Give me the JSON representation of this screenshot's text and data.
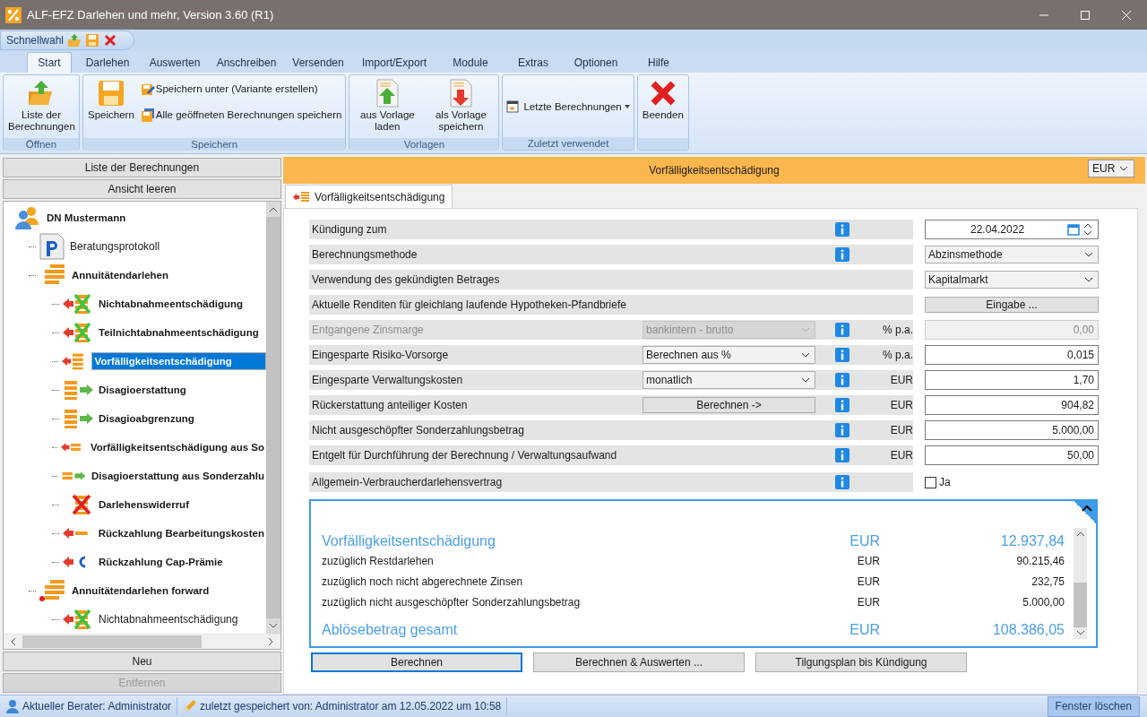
{
  "window": {
    "title": "ALF-EFZ Darlehen und mehr, Version 3.60 (R1)"
  },
  "quick_access": {
    "label": "Schnellwahl"
  },
  "ribbon_tabs": [
    {
      "label": "Start",
      "selected": true
    },
    {
      "label": "Darlehen",
      "selected": false
    },
    {
      "label": "Auswerten",
      "selected": false
    },
    {
      "label": "Anschreiben",
      "selected": false
    },
    {
      "label": "Versenden",
      "selected": false
    },
    {
      "label": "Import/Export",
      "selected": false
    },
    {
      "label": "Module",
      "selected": false
    },
    {
      "label": "Extras",
      "selected": false
    },
    {
      "label": "Optionen",
      "selected": false
    },
    {
      "label": "Hilfe",
      "selected": false
    }
  ],
  "ribbon_groups": [
    {
      "label": "Öffnen",
      "items": [
        {
          "kind": "large",
          "label": "Liste der Berechnungen"
        }
      ]
    },
    {
      "label": "Speichern",
      "items": [
        {
          "kind": "large",
          "label": "Speichern"
        },
        {
          "kind": "small",
          "label": "Speichern unter (Variante erstellen)"
        },
        {
          "kind": "small",
          "label": "Alle geöffneten Berechnungen speichern"
        }
      ]
    },
    {
      "label": "Vorlagen",
      "items": [
        {
          "kind": "large",
          "label": "aus Vorlage laden"
        },
        {
          "kind": "large",
          "label": "als Vorlage speichern"
        }
      ]
    },
    {
      "label": "Zuletzt verwendet",
      "items": [
        {
          "kind": "dropdown",
          "label": "Letzte Berechnungen"
        }
      ]
    },
    {
      "items": [
        {
          "kind": "large",
          "label": "Beenden"
        }
      ]
    }
  ],
  "left_panel": {
    "top_buttons": [
      "Liste der Berechnungen",
      "Ansicht leeren"
    ],
    "tree": [
      {
        "kind": "client",
        "label": "DN Mustermann",
        "emphasized": true,
        "selected": false,
        "children": [
          {
            "kind": "protocol",
            "label": "Beratungsprotokoll",
            "emphasized": false,
            "selected": false
          },
          {
            "kind": "loan",
            "label": "Annuitätendarlehen",
            "emphasized": true,
            "selected": false,
            "children": [
              {
                "kind": "penalty-x",
                "label": "Nichtabnahmeentschädigung",
                "emphasized": true,
                "selected": false
              },
              {
                "kind": "penalty-x",
                "label": "Teilnichtabnahmeentschädigung",
                "emphasized": true,
                "selected": false
              },
              {
                "kind": "penalty",
                "label": "Vorfälligkeitsentschädigung",
                "emphasized": true,
                "selected": true
              },
              {
                "kind": "refund",
                "label": "Disagioerstattung",
                "emphasized": true,
                "selected": false
              },
              {
                "kind": "refund",
                "label": "Disagioabgrenzung",
                "emphasized": true,
                "selected": false
              },
              {
                "kind": "penalty-small",
                "label": "Vorfälligkeitsentschädigung aus So",
                "emphasized": true,
                "selected": false
              },
              {
                "kind": "refund-small",
                "label": "Disagioerstattung aus Sonderzahlu",
                "emphasized": true,
                "selected": false
              },
              {
                "kind": "revocation",
                "label": "Darlehenswiderruf",
                "emphasized": true,
                "selected": false
              },
              {
                "kind": "cost",
                "label": "Rückzahlung Bearbeitungskosten",
                "emphasized": true,
                "selected": false
              },
              {
                "kind": "cap",
                "label": "Rückzahlung Cap-Prämie",
                "emphasized": true,
                "selected": false
              }
            ]
          },
          {
            "kind": "loan-forward",
            "label": "Annuitätendarlehen forward",
            "emphasized": true,
            "selected": false,
            "children": [
              {
                "kind": "penalty-x",
                "label": "Nichtabnahmeentschädigung",
                "emphasized": false,
                "selected": false
              }
            ]
          }
        ]
      }
    ],
    "bottom_buttons": [
      {
        "label": "Neu",
        "disabled": false
      },
      {
        "label": "Entfernen",
        "disabled": true
      }
    ]
  },
  "header": {
    "title": "Vorfälligkeitsentschädigung",
    "currency": "EUR"
  },
  "doc_tab": {
    "label": "Vorfälligkeitsentschädigung"
  },
  "form_rows": [
    {
      "label": "Kündigung zum",
      "disabled": false,
      "info": true,
      "control": {
        "kind": "date",
        "value": "22.04.2022"
      }
    },
    {
      "label": "Berechnungsmethode",
      "disabled": false,
      "info": true,
      "control": {
        "kind": "select",
        "value": "Abzinsmethode"
      }
    },
    {
      "label": "Verwendung des gekündigten Betrages",
      "disabled": false,
      "info": false,
      "control": {
        "kind": "select",
        "value": "Kapitalmarkt"
      }
    },
    {
      "label": "Aktuelle Renditen für gleichlang laufende Hypotheken-Pfandbriefe",
      "disabled": false,
      "info": false,
      "control": {
        "kind": "button",
        "value": "Eingabe ..."
      }
    },
    {
      "label": "Entgangene Zinsmarge",
      "disabled": true,
      "middle": {
        "kind": "select",
        "value": "bankintern - brutto"
      },
      "info": true,
      "unit": "% p.a.",
      "control": {
        "kind": "input",
        "value": "0,00"
      }
    },
    {
      "label": "Eingesparte Risiko-Vorsorge",
      "disabled": false,
      "middle": {
        "kind": "select",
        "value": "Berechnen aus %"
      },
      "info": true,
      "unit": "% p.a.",
      "control": {
        "kind": "input",
        "value": "0,015"
      }
    },
    {
      "label": "Eingesparte Verwaltungskosten",
      "disabled": false,
      "middle": {
        "kind": "select",
        "value": "monatlich"
      },
      "info": true,
      "unit": "EUR",
      "control": {
        "kind": "input",
        "value": "1,70"
      }
    },
    {
      "label": "Rückerstattung anteiliger Kosten",
      "disabled": false,
      "middle": {
        "kind": "button",
        "value": "Berechnen ->"
      },
      "info": true,
      "unit": "EUR",
      "control": {
        "kind": "input",
        "value": "904,82"
      }
    },
    {
      "label": "Nicht ausgeschöpfter Sonderzahlungsbetrag",
      "disabled": false,
      "info": true,
      "unit": "EUR",
      "control": {
        "kind": "input",
        "value": "5.000,00"
      }
    },
    {
      "label": "Entgelt für Durchführung der Berechnung / Verwaltungsaufwand",
      "disabled": false,
      "info": true,
      "unit": "EUR",
      "control": {
        "kind": "input",
        "value": "50,00"
      }
    },
    {
      "label": "Allgemein-Verbraucherdarlehensvertrag",
      "disabled": false,
      "info": true,
      "control": {
        "kind": "checkbox",
        "value": "Ja",
        "checked": false
      }
    }
  ],
  "results": {
    "expanded": true,
    "lines": [
      {
        "kind": "main",
        "label": "Vorfälligkeitsentschädigung",
        "unit": "EUR",
        "value": "12.937,84"
      },
      {
        "kind": "sub",
        "label": "zuzüglich Restdarlehen",
        "unit": "EUR",
        "value": "90.215,46"
      },
      {
        "kind": "sub",
        "label": "zuzüglich noch nicht abgerechnete Zinsen",
        "unit": "EUR",
        "value": "232,75"
      },
      {
        "kind": "sub",
        "label": "zuzüglich nicht ausgeschöpfter Sonderzahlungsbetrag",
        "unit": "EUR",
        "value": "5.000,00"
      },
      {
        "kind": "main",
        "label": "Ablösebetrag gesamt",
        "unit": "EUR",
        "value": "108.386,05"
      }
    ]
  },
  "actions": [
    {
      "label": "Berechnen",
      "selected": true
    },
    {
      "label": "Berechnen & Auswerten ...",
      "selected": false
    },
    {
      "label": "Tilgungsplan bis Kündigung",
      "selected": false
    }
  ],
  "status_bar": {
    "advisor": "Aktueller Berater: Administrator",
    "saved": "zuletzt gespeichert von: Administrator am 12.05.2022 um 10:58",
    "button": "Fenster löschen"
  }
}
